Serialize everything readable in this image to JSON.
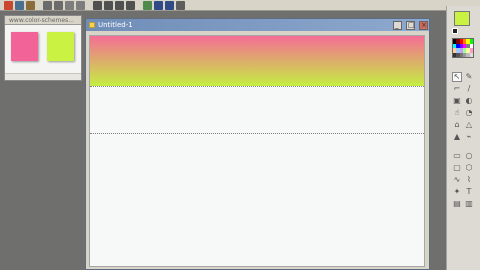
{
  "document": {
    "title": "Untitled-1"
  },
  "colors": {
    "window_bg": "#6f6f6e",
    "gradient_top": "#f56d95",
    "gradient_bottom": "#c5ee42",
    "swatch_pink": "#f26497",
    "swatch_lime": "#c9f242",
    "foreground": "#c9f242"
  },
  "thumbnail_window": {
    "title": "www.color-schemes..."
  },
  "toolbar": {
    "icons": [
      "new-icon",
      "open-icon",
      "cut-icon",
      "zoom-in-icon",
      "zoom-out-icon",
      "hand-icon",
      "lasso-icon",
      "marquee-icon",
      "line-icon",
      "eraser-icon",
      "pencil-icon",
      "fill-icon",
      "dropper-icon",
      "shape-icon",
      "text-icon"
    ]
  },
  "tools": [
    "arrow-icon",
    "pen-icon",
    "brush-icon",
    "pencil-icon",
    "eraser-icon",
    "fill-icon",
    "smudge-icon",
    "dodge-icon",
    "drop-icon",
    "sharpen-icon",
    "stamp-icon",
    "eyedropper-icon",
    "rectangle-icon",
    "ellipse-icon",
    "rounded-rectangle-icon",
    "polygon-icon",
    "freeform-icon",
    "lasso-icon",
    "custom-shape-icon",
    "text-icon",
    "mode-icon",
    "screen-icon"
  ]
}
